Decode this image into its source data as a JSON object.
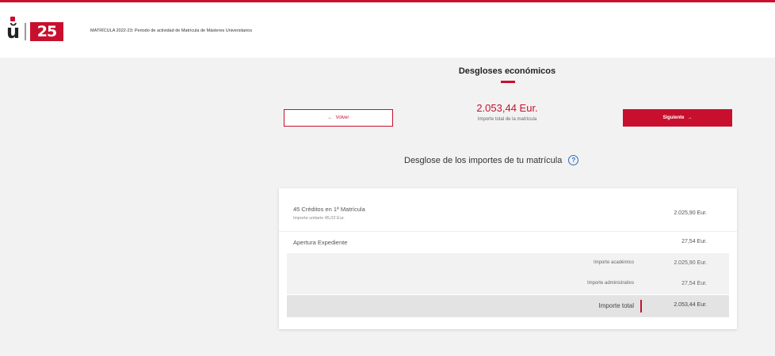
{
  "header": {
    "logo_letter": "ŭ",
    "logo_number": "25",
    "title": "MATRÍCULA 2022-23: Periodo de actividad de Matrícula de Másteres Universitarios"
  },
  "page": {
    "title": "Desgloses económicos"
  },
  "nav": {
    "back_label": "Volver",
    "back_icon": "←",
    "next_label": "Siguiente",
    "next_icon": "→"
  },
  "summary": {
    "total_amount": "2.053,44 Eur.",
    "total_caption": "Importe total de la matrícula"
  },
  "breakdown": {
    "heading": "Desglose de los importes de tu matrícula",
    "help_icon": "?",
    "items": [
      {
        "label": "45 Créditos en 1ª Matrícula",
        "sublabel": "Importe unitario 45,02 Eur.",
        "amount": "2.025,90 Eur."
      },
      {
        "label": "Apertura Expediente",
        "amount": "27,54 Eur."
      }
    ],
    "subtotals": [
      {
        "label": "Importe académico",
        "amount": "2.025,90 Eur."
      },
      {
        "label": "Importe administrativo",
        "amount": "27,54 Eur."
      }
    ],
    "total": {
      "label": "Importe total",
      "amount": "2.053,44 Eur."
    }
  },
  "colors": {
    "accent": "#c8102e",
    "background": "#f2f2f2",
    "help": "#2a6ebb"
  }
}
